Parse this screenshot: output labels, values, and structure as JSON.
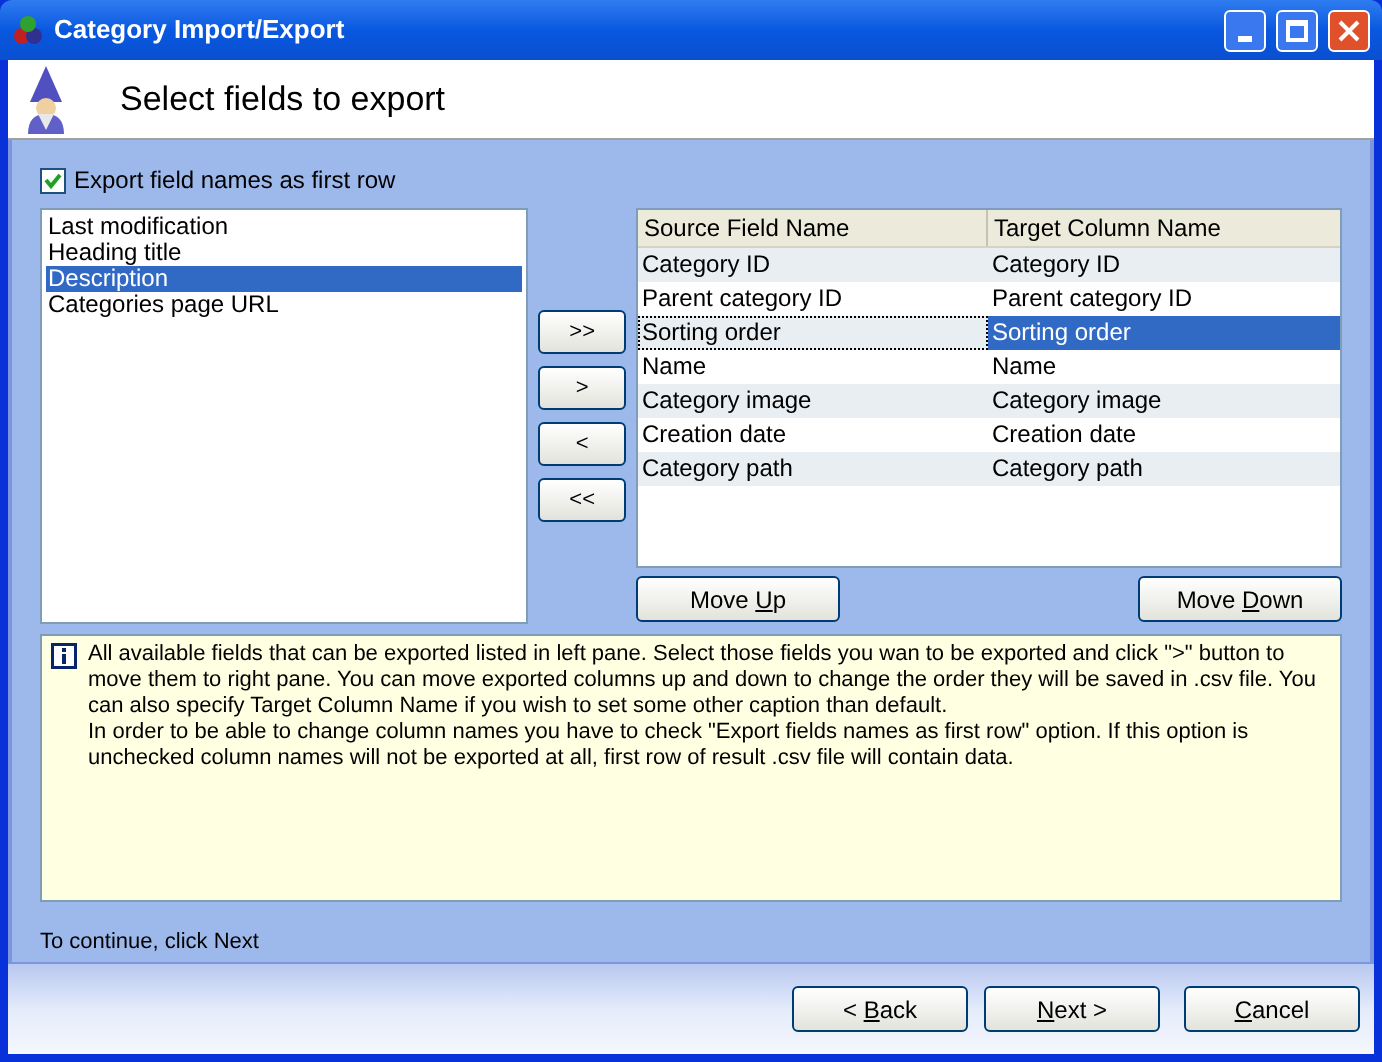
{
  "window": {
    "title": "Category Import/Export"
  },
  "header": {
    "title": "Select fields to export"
  },
  "export_names": {
    "label": "Export field names as first row",
    "checked": true
  },
  "available_fields": [
    {
      "label": "Last modification",
      "selected": false
    },
    {
      "label": "Heading title",
      "selected": false
    },
    {
      "label": "Description",
      "selected": true
    },
    {
      "label": "Categories page URL",
      "selected": false
    }
  ],
  "move_buttons": [
    ">>",
    ">",
    "<",
    "<<"
  ],
  "table": {
    "columns": [
      "Source Field Name",
      "Target Column Name"
    ],
    "rows": [
      {
        "source": "Category ID",
        "target": "Category ID",
        "selected": false
      },
      {
        "source": "Parent category ID",
        "target": "Parent category ID",
        "selected": false
      },
      {
        "source": "Sorting order",
        "target": "Sorting order",
        "selected": true
      },
      {
        "source": "Name",
        "target": "Name",
        "selected": false
      },
      {
        "source": "Category image",
        "target": "Category image",
        "selected": false
      },
      {
        "source": "Creation date",
        "target": "Creation date",
        "selected": false
      },
      {
        "source": "Category path",
        "target": "Category path",
        "selected": false
      }
    ]
  },
  "order_buttons": [
    {
      "before": "Move ",
      "key": "U",
      "after": "p"
    },
    {
      "before": "Move ",
      "key": "D",
      "after": "own"
    }
  ],
  "info": [
    "All available fields that can be exported listed in left pane. Select those fields you wan to be exported and click \">\" button to move them to right pane. You can move exported columns up and down to change the order they will be saved in .csv file. You can also specify Target Column Name if you wish to set some other caption than default.",
    "In order to be able to change column names you have to check \"Export fields names as first row\" option. If this option is unchecked column names will not be exported at all, first row of result .csv file will contain data."
  ],
  "status": "To continue, click Next",
  "footer_buttons": [
    {
      "before": "< ",
      "key": "B",
      "after": "ack"
    },
    {
      "key": "N",
      "after": "ext >"
    },
    {
      "key": "C",
      "after": "ancel"
    }
  ]
}
